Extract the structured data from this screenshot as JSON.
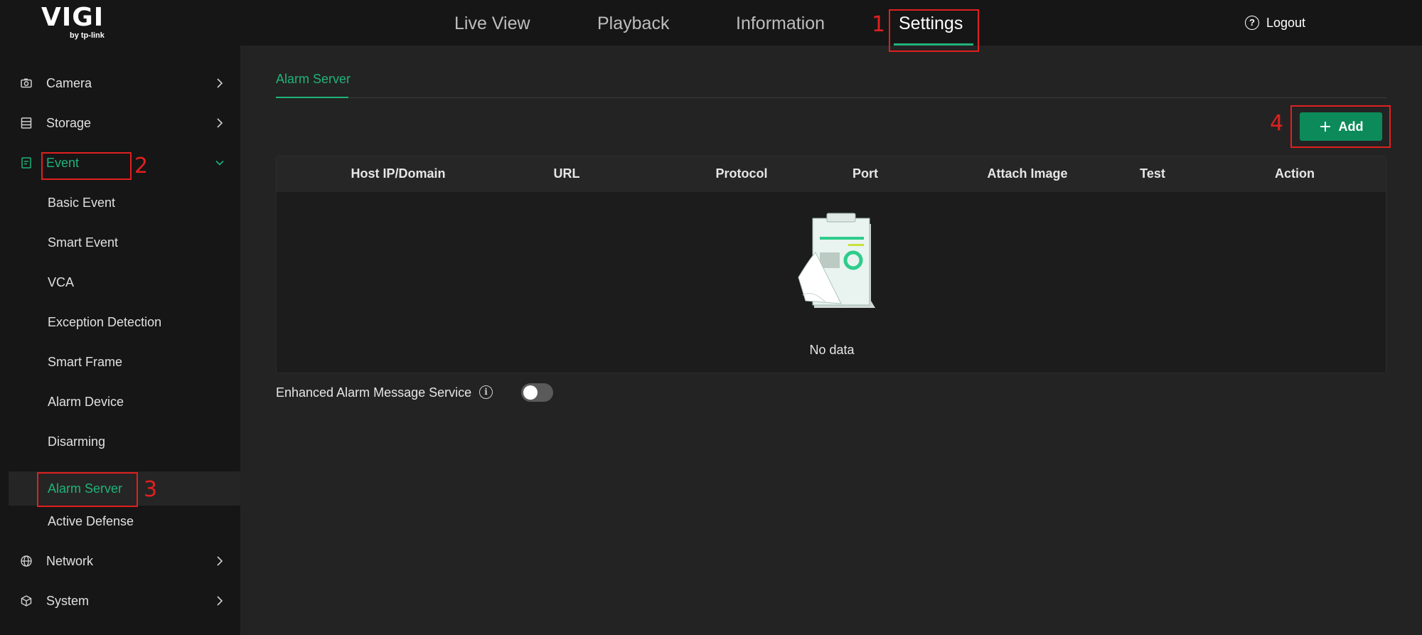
{
  "brand": {
    "logo": "VIGI",
    "logo_sub": "by tp-link"
  },
  "nav": {
    "items": [
      {
        "label": "Live View"
      },
      {
        "label": "Playback"
      },
      {
        "label": "Information"
      },
      {
        "label": "Settings",
        "active": true
      }
    ],
    "logout": "Logout"
  },
  "sidebar": {
    "items": [
      {
        "label": "Camera",
        "icon": "camera-icon"
      },
      {
        "label": "Storage",
        "icon": "storage-icon"
      },
      {
        "label": "Event",
        "icon": "event-icon",
        "expanded": true
      },
      {
        "label": "Basic Event"
      },
      {
        "label": "Smart Event"
      },
      {
        "label": "VCA"
      },
      {
        "label": "Exception Detection"
      },
      {
        "label": "Smart Frame"
      },
      {
        "label": "Alarm Device"
      },
      {
        "label": "Disarming"
      },
      {
        "label": "Alarm Server",
        "active": true
      },
      {
        "label": "Active Defense"
      },
      {
        "label": "Network",
        "icon": "globe-icon"
      },
      {
        "label": "System",
        "icon": "cube-icon"
      }
    ]
  },
  "main": {
    "tab": "Alarm Server",
    "add_label": "Add",
    "table": {
      "columns": [
        "Host IP/Domain",
        "URL",
        "Protocol",
        "Port",
        "Attach Image",
        "Test",
        "Action"
      ],
      "rows": [],
      "empty_text": "No data"
    },
    "enhanced": {
      "label": "Enhanced Alarm Message Service",
      "enabled": false
    }
  },
  "annotations": [
    "1",
    "2",
    "3",
    "4"
  ],
  "colors": {
    "accent": "#1fb37a",
    "button": "#0d8a5a",
    "annotation": "#e02020"
  }
}
